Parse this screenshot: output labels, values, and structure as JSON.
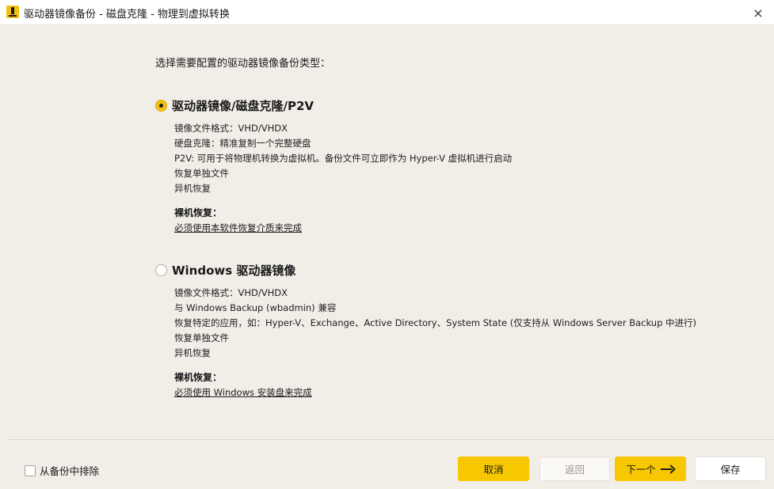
{
  "window": {
    "title": "驱动器镜像备份 - 磁盘克隆 - 物理到虚拟转换",
    "close_icon": "×"
  },
  "main": {
    "prompt": "选择需要配置的驱动器镜像备份类型：",
    "options": [
      {
        "title": "驱动器镜像/磁盘克隆/P2V",
        "selected": true,
        "features": [
          "镜像文件格式：VHD/VHDX",
          "硬盘克隆：精准复制一个完整硬盘",
          "P2V: 可用于将物理机转换为虚拟机。备份文件可立即作为 Hyper-V 虚拟机进行启动",
          "恢复单独文件",
          "异机恢复"
        ],
        "bmr_heading": "裸机恢复：",
        "bmr_link": "必须使用本软件恢复介质来完成"
      },
      {
        "title": "Windows 驱动器镜像",
        "selected": false,
        "features": [
          "镜像文件格式：VHD/VHDX",
          "与 Windows Backup (wbadmin) 兼容",
          "恢复特定的应用，如：Hyper-V、Exchange、Active Directory、System State (仅支持从 Windows Server Backup 中进行)",
          "恢复单独文件",
          "异机恢复"
        ],
        "bmr_heading": "裸机恢复：",
        "bmr_link": "必须使用 Windows 安装盘来完成"
      }
    ]
  },
  "footer": {
    "exclude_label": "从备份中排除",
    "exclude_checked": false,
    "cancel_label": "取消",
    "back_label": "返回",
    "next_label": "下一个",
    "save_label": "保存"
  },
  "colors": {
    "accent": "#f7c800",
    "background": "#f1ede7"
  }
}
